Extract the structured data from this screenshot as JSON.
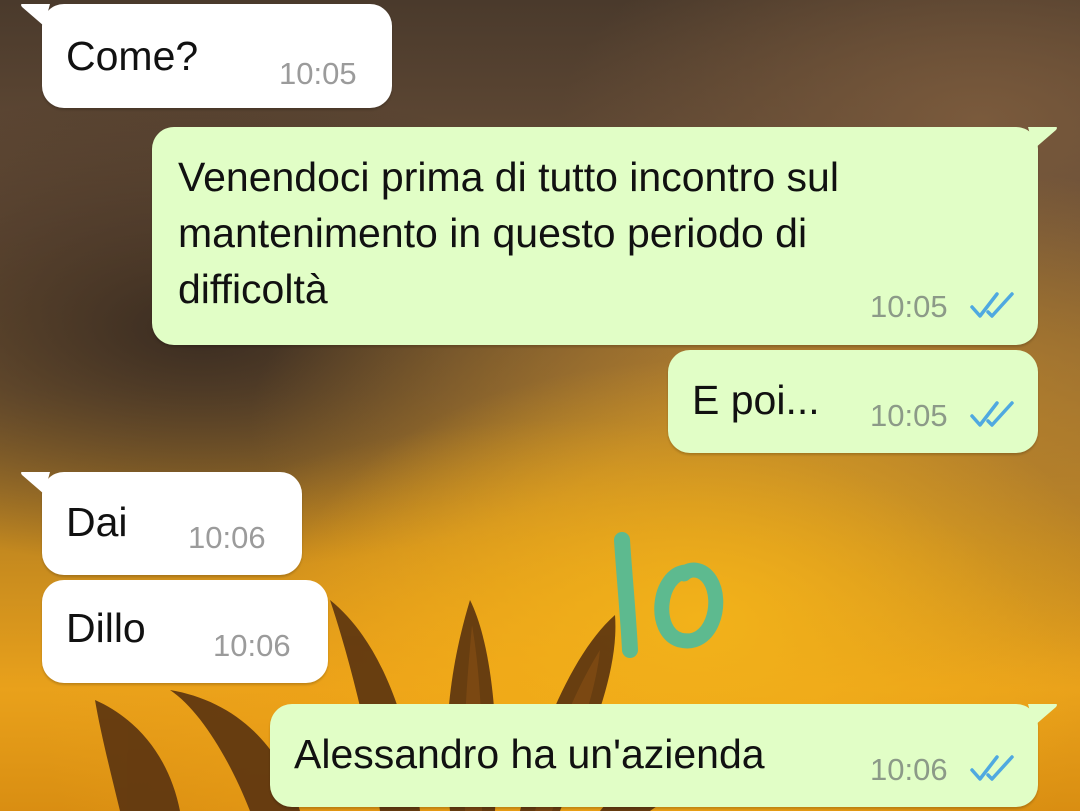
{
  "messages": [
    {
      "direction": "incoming",
      "text": "Come?",
      "time": "10:05"
    },
    {
      "direction": "outgoing",
      "lines": [
        "Venendoci prima di tutto incontro sul",
        "mantenimento in questo periodo di",
        "difficoltà"
      ],
      "time": "10:05",
      "status": "read"
    },
    {
      "direction": "outgoing",
      "text": "E poi...",
      "time": "10:05",
      "status": "read"
    },
    {
      "direction": "incoming",
      "text": "Dai",
      "time": "10:06"
    },
    {
      "direction": "incoming",
      "text": "Dillo",
      "time": "10:06"
    },
    {
      "direction": "outgoing",
      "text": "Alessandro ha un'azienda",
      "time": "10:06",
      "status": "read"
    }
  ],
  "overlay_annotation": "10",
  "colors": {
    "incoming_bubble": "#ffffff",
    "outgoing_bubble": "#e1fec6",
    "read_ticks": "#4fa9e0",
    "annotation": "#5dba8f"
  },
  "icons": {
    "read_receipt": "double-check-icon"
  }
}
